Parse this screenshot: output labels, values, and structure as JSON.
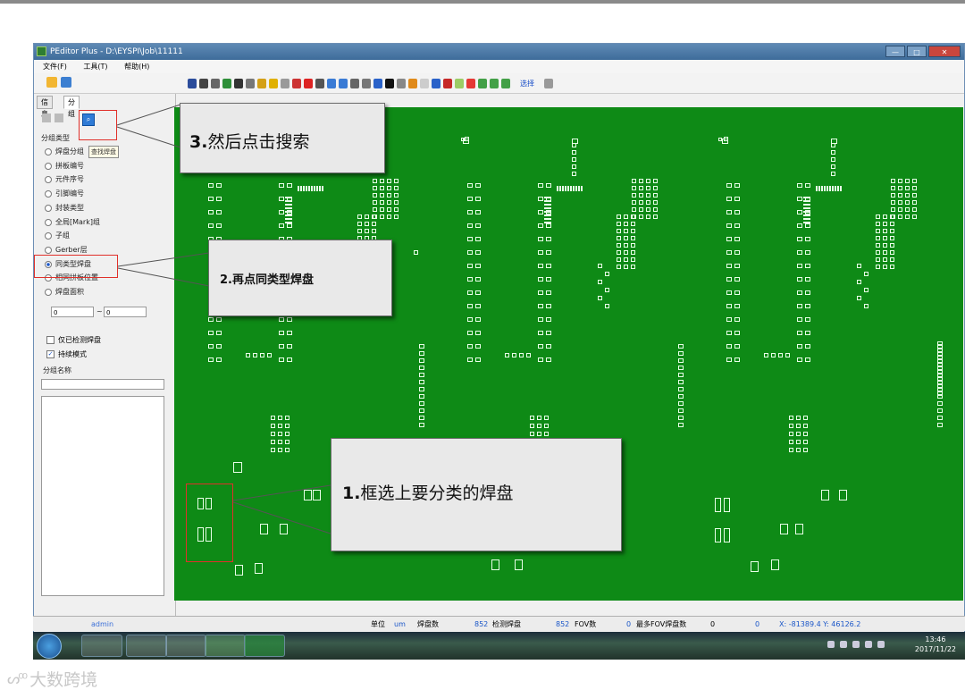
{
  "window": {
    "title": "PEditor Plus - D:\\EYSPI\\Job\\11111",
    "controls": [
      "—",
      "□",
      "✕"
    ]
  },
  "menu": [
    "文件(F)",
    "工具(T)",
    "帮助(H)"
  ],
  "toolbar": {
    "select_label": "选择"
  },
  "panel": {
    "tabs": [
      "信息",
      "分组"
    ],
    "tooltip": "查找焊盘",
    "group_type_label": "分组类型",
    "group_types": [
      "焊盘分组",
      "拼板编号",
      "元件序号",
      "引脚编号",
      "封装类型",
      "全局[Mark]组",
      "子组",
      "Gerber层",
      "同类型焊盘",
      "相同拼板位置",
      "焊盘面积"
    ],
    "selected_group_type": "同类型焊盘",
    "area_min": "0",
    "area_dash": "~",
    "area_max": "0",
    "checkboxes": [
      {
        "label": "仅已检测焊盘",
        "checked": false
      },
      {
        "label": "持续模式",
        "checked": true
      }
    ],
    "group_name_label": "分组名称",
    "group_name_value": ""
  },
  "status": {
    "user": "admin",
    "unit_label": "单位",
    "unit_value": "um",
    "pad_count_label": "焊盘数",
    "pad_count": "852",
    "inspected_label": "检测焊盘",
    "inspected_count": "852",
    "fov_label": "FOV数",
    "fov_count": "0",
    "max_fov_label": "最多FOV焊盘数",
    "max_fov_count": "0",
    "extra_count": "0",
    "coords": "X: -81389.4  Y: 46126.2"
  },
  "taskbar": {
    "time": "13:46",
    "date": "2017/11/22"
  },
  "callouts": {
    "step3_num": "3.",
    "step3_text": "然后点击搜索",
    "step2_num": "2.",
    "step2_text": "再点同类型焊盘",
    "step1_num": "1.",
    "step1_text": "框选上要分类的焊盘"
  },
  "watermark": "大数跨境",
  "colors": {
    "board": "#0e8a16",
    "highlight": "#e0302a",
    "accent": "#1a56c8"
  }
}
